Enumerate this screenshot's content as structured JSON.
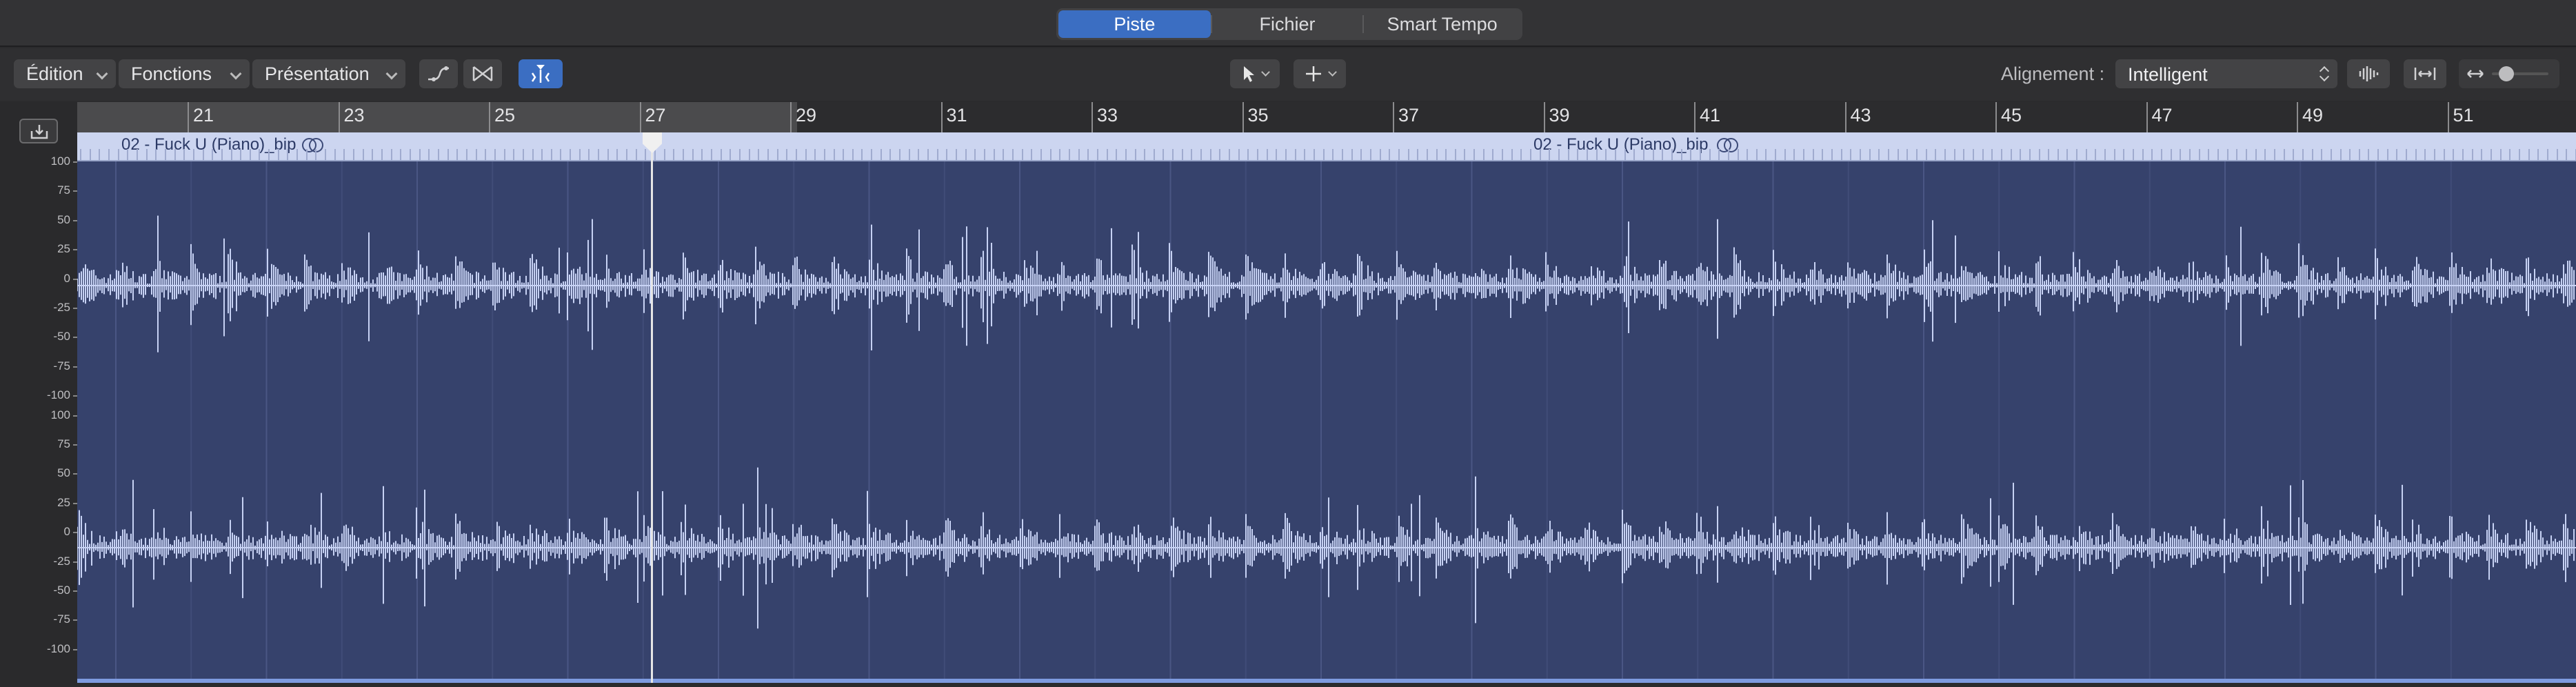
{
  "tabs": [
    {
      "label": "Piste",
      "active": true
    },
    {
      "label": "Fichier",
      "active": false
    },
    {
      "label": "Smart Tempo",
      "active": false
    }
  ],
  "menus": {
    "edit": "Édition",
    "functions": "Fonctions",
    "view": "Présentation"
  },
  "alignment": {
    "label": "Alignement :",
    "value": "Intelligent"
  },
  "ruler": {
    "bars": [
      "21",
      "23",
      "25",
      "27",
      "29",
      "31",
      "33",
      "35",
      "37",
      "39",
      "41",
      "43",
      "45",
      "47",
      "49",
      "51"
    ]
  },
  "scale": {
    "labels": [
      "100",
      "75",
      "50",
      "25",
      "0",
      "-25",
      "-50",
      "-75",
      "-100",
      "100",
      "75",
      "50",
      "25",
      "0",
      "-25",
      "-50",
      "-75",
      "-100"
    ]
  },
  "region": {
    "name_1": "02 - Fuck U (Piano)_bip",
    "name_2": "02 - Fuck U (Piano)_bip"
  },
  "icons": {
    "gutter": "download-tray-icon",
    "curve": "curve-tool-icon",
    "flex": "flex-tool-icon",
    "marker": "flex-marker-icon",
    "pointer": "pointer-tool-icon",
    "crosshair": "marquee-tool-icon",
    "waveform": "waveform-zoom-icon",
    "fit": "fit-width-icon",
    "horizontal_zoom": "horizontal-zoom-icon"
  },
  "colors": {
    "accent": "#3b6ec2",
    "region": "#36426c",
    "waveform": "#c7d2f4",
    "region_header": "#ccd5f0"
  }
}
